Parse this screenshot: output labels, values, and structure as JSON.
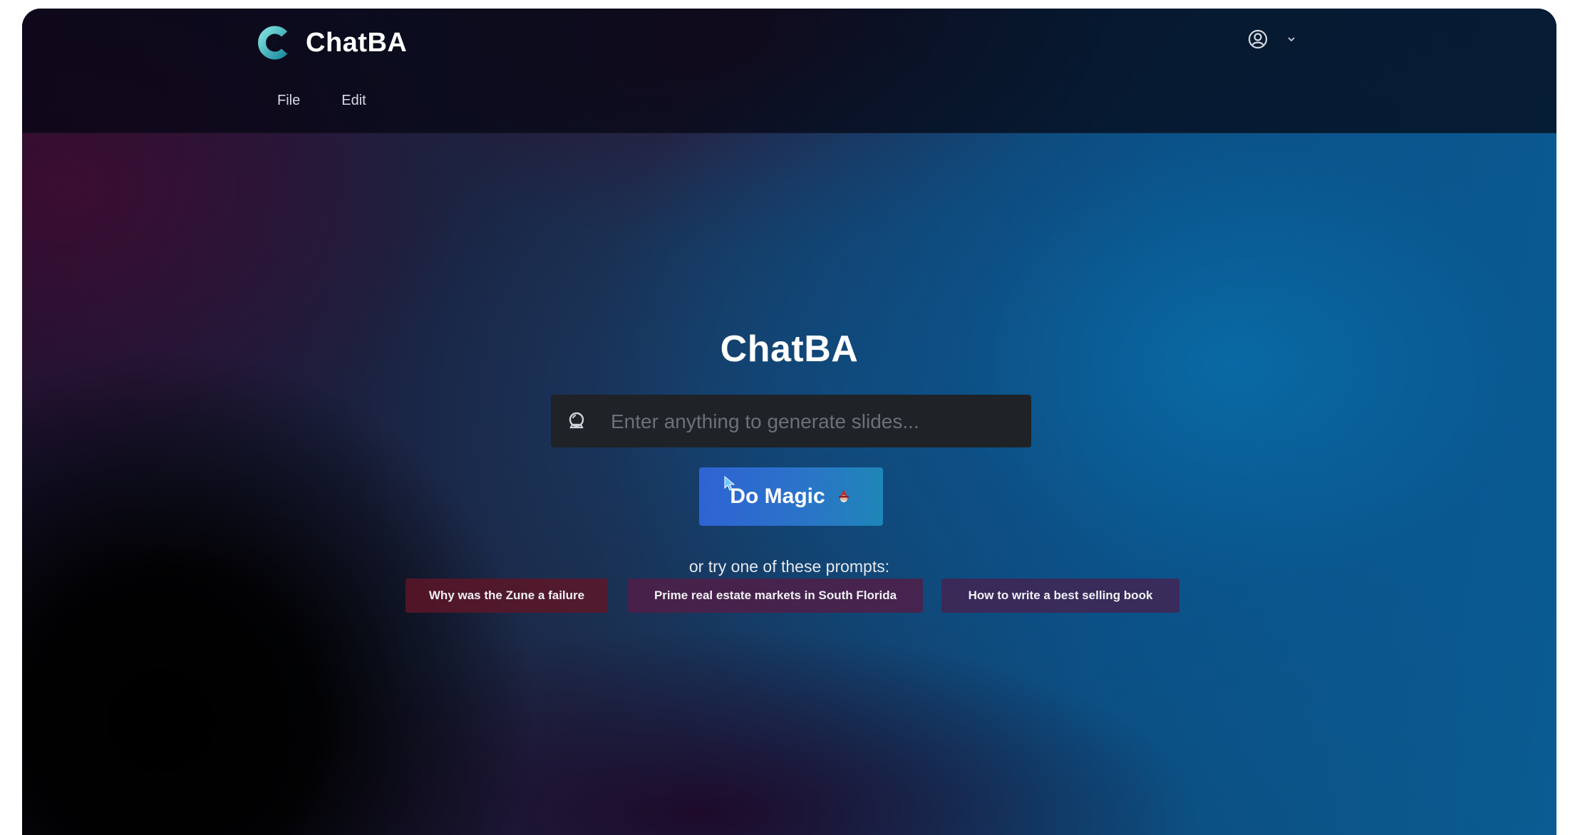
{
  "app": {
    "name": "ChatBA"
  },
  "menu": {
    "items": [
      "File",
      "Edit"
    ]
  },
  "hero": {
    "title": "ChatBA"
  },
  "search": {
    "placeholder": "Enter anything to generate slides...",
    "value": ""
  },
  "action": {
    "label": "Do Magic"
  },
  "prompts": {
    "label": "or try one of these prompts:",
    "items": [
      "Why was the Zune a failure",
      "Prime real estate markets in South Florida",
      "How to write a best selling book"
    ]
  },
  "icons": {
    "logo": "chatba-logo-icon",
    "account": "user-circle-icon",
    "dropdown": "chevron-down-icon",
    "search": "crystal-ball-icon",
    "magic": "mage-emoji-icon"
  },
  "colors": {
    "accent": "#2e63d3",
    "logo_teal": "#4fc3c7"
  }
}
